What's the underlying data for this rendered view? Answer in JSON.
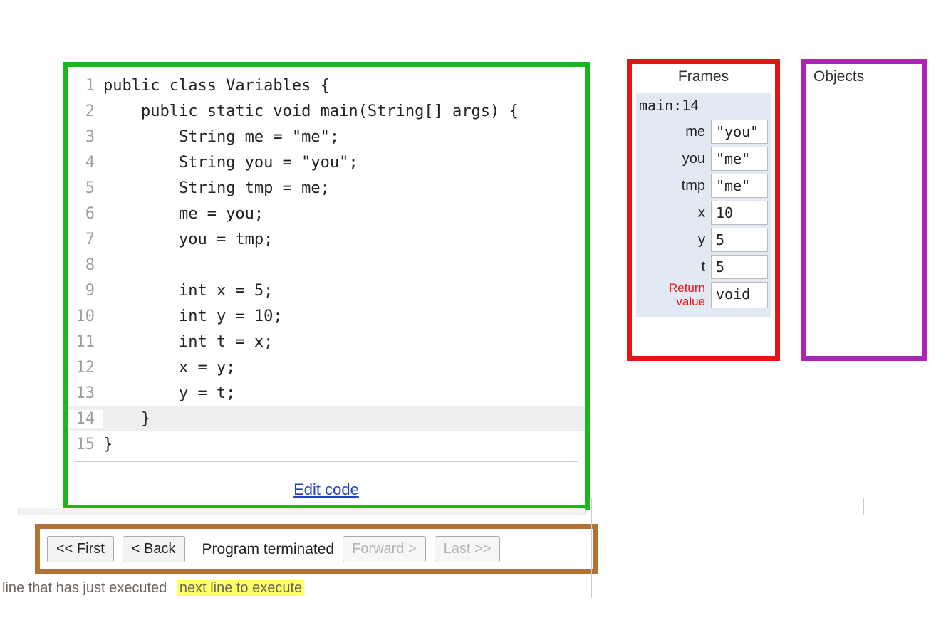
{
  "code": {
    "lines": [
      {
        "n": "1",
        "text": "public class Variables {",
        "hl": false
      },
      {
        "n": "2",
        "text": "    public static void main(String[] args) {",
        "hl": false
      },
      {
        "n": "3",
        "text": "        String me = \"me\";",
        "hl": false
      },
      {
        "n": "4",
        "text": "        String you = \"you\";",
        "hl": false
      },
      {
        "n": "5",
        "text": "        String tmp = me;",
        "hl": false
      },
      {
        "n": "6",
        "text": "        me = you;",
        "hl": false
      },
      {
        "n": "7",
        "text": "        you = tmp;",
        "hl": false
      },
      {
        "n": "8",
        "text": "",
        "hl": false
      },
      {
        "n": "9",
        "text": "        int x = 5;",
        "hl": false
      },
      {
        "n": "10",
        "text": "        int y = 10;",
        "hl": false
      },
      {
        "n": "11",
        "text": "        int t = x;",
        "hl": false
      },
      {
        "n": "12",
        "text": "        x = y;",
        "hl": false
      },
      {
        "n": "13",
        "text": "        y = t;",
        "hl": false
      },
      {
        "n": "14",
        "text": "    }",
        "hl": true
      },
      {
        "n": "15",
        "text": "}",
        "hl": false
      }
    ],
    "edit_link": "Edit code"
  },
  "nav": {
    "first": "<< First",
    "back": "< Back",
    "status": "Program terminated",
    "forward": "Forward >",
    "last": "Last >>"
  },
  "legend": {
    "just": "line that has just executed",
    "next": "next line to execute"
  },
  "frames": {
    "title": "Frames",
    "frame_header": "main:14",
    "vars": [
      {
        "name": "me",
        "value": "\"you\""
      },
      {
        "name": "you",
        "value": "\"me\""
      },
      {
        "name": "tmp",
        "value": "\"me\""
      },
      {
        "name": "x",
        "value": "10"
      },
      {
        "name": "y",
        "value": "5"
      },
      {
        "name": "t",
        "value": "5"
      }
    ],
    "return_label": "Return value",
    "return_value": "void"
  },
  "objects": {
    "title": "Objects"
  }
}
